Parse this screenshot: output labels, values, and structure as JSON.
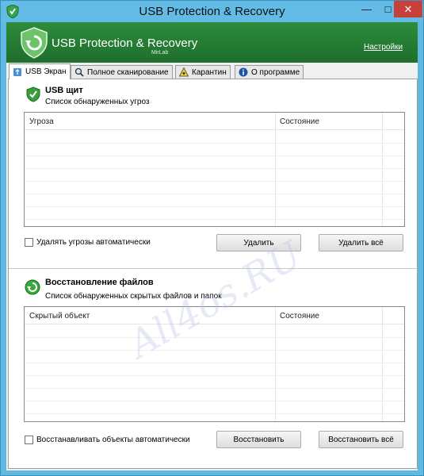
{
  "window": {
    "title": "USB Protection & Recovery"
  },
  "banner": {
    "app_name": "USB Protection & Recovery",
    "vendor": "MirLab",
    "settings_link": "Настройки",
    "color": "#2a8539"
  },
  "tabs": [
    {
      "label": "USB Экран",
      "icon": "usb-icon",
      "active": true
    },
    {
      "label": "Полное сканирование",
      "icon": "magnifier-icon",
      "active": false
    },
    {
      "label": "Карантин",
      "icon": "biohazard-icon",
      "active": false
    },
    {
      "label": "О программе",
      "icon": "info-icon",
      "active": false
    }
  ],
  "usb_shield": {
    "title": "USB щит",
    "subtitle": "Список обнаруженных угроз",
    "columns": [
      "Угроза",
      "Состояние"
    ],
    "rows": [],
    "auto_checkbox": {
      "label": "Удалять угрозы автоматически",
      "checked": false
    },
    "delete_button": "Удалить",
    "delete_all_button": "Удалить всё"
  },
  "recovery": {
    "title": "Восстановление файлов",
    "subtitle": "Список обнаруженных скрытых файлов и папок",
    "columns": [
      "Скрытый объект",
      "Состояние"
    ],
    "rows": [],
    "auto_checkbox": {
      "label": "Восстанавливать объекты автоматически",
      "checked": false
    },
    "restore_button": "Восстановить",
    "restore_all_button": "Восстановить всё"
  },
  "watermark": "All4os.RU"
}
